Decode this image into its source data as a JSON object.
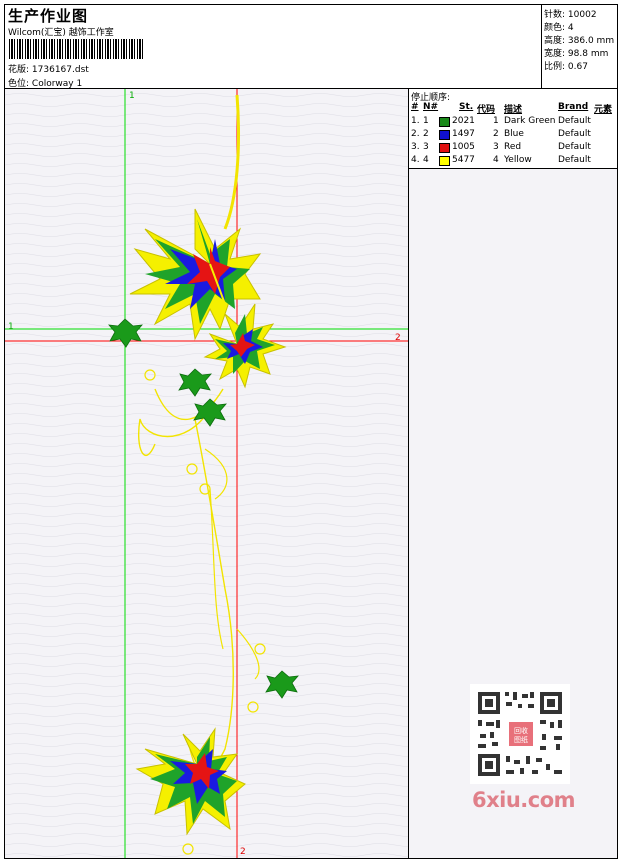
{
  "header": {
    "title": "生产作业图",
    "subtitle": "Wilcom(汇宝) 越饰工作室",
    "design_label": "花版:",
    "design_value": "1736167.dst",
    "colorway_label": "色位:",
    "colorway_value": "Colorway 1"
  },
  "stats": [
    {
      "label": "针数:",
      "value": "10002"
    },
    {
      "label": "颜色:",
      "value": "4"
    },
    {
      "label": "高度:",
      "value": "386.0 mm"
    },
    {
      "label": "宽度:",
      "value": "98.8 mm"
    },
    {
      "label": "比例:",
      "value": "0.67"
    }
  ],
  "stop_panel": {
    "title": "停止顺序:",
    "columns": {
      "num": "#",
      "n": "N#",
      "st": "St.",
      "code": "代码",
      "desc": "描述",
      "brand": "Brand",
      "element": "元素"
    },
    "rows": [
      {
        "num": "1.",
        "n": "1",
        "color": "#1a8a1a",
        "st": "2021",
        "code": "1",
        "desc": "Dark Green",
        "brand": "Default"
      },
      {
        "num": "2.",
        "n": "2",
        "color": "#1010d0",
        "st": "1497",
        "code": "2",
        "desc": "Blue",
        "brand": "Default"
      },
      {
        "num": "3.",
        "n": "3",
        "color": "#e01010",
        "st": "1005",
        "code": "3",
        "desc": "Red",
        "brand": "Default"
      },
      {
        "num": "4.",
        "n": "4",
        "color": "#ffff00",
        "st": "5477",
        "code": "4",
        "desc": "Yellow",
        "brand": "Default"
      }
    ]
  },
  "axes": {
    "green_top": "1",
    "green_left": "1",
    "red_right": "2",
    "red_bottom": "2"
  },
  "watermark": {
    "text": "6xiu.com",
    "seal": "回收图纸"
  }
}
